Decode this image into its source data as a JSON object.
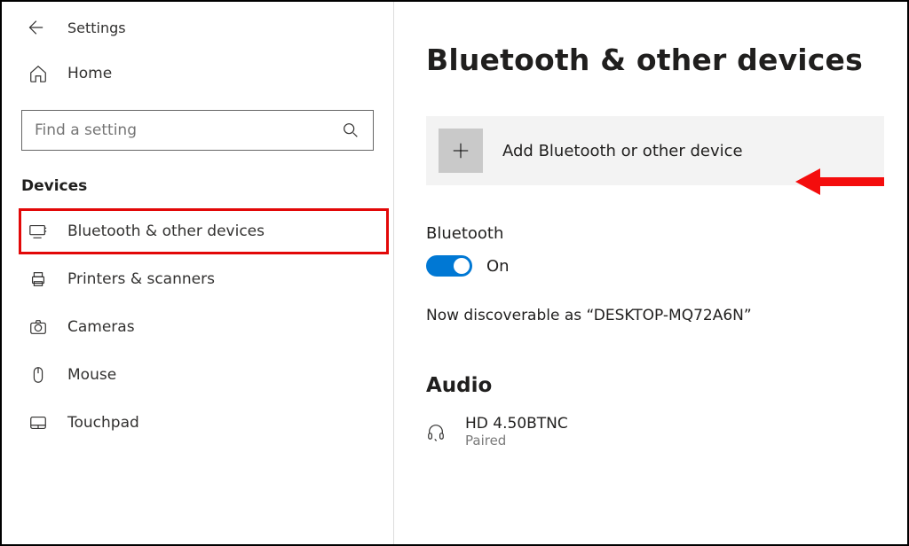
{
  "header": {
    "title": "Settings"
  },
  "home": {
    "label": "Home"
  },
  "search": {
    "placeholder": "Find a setting"
  },
  "category": {
    "heading": "Devices"
  },
  "nav": {
    "items": [
      {
        "label": "Bluetooth & other devices",
        "icon": "bluetooth-devices-icon",
        "selected": true
      },
      {
        "label": "Printers & scanners",
        "icon": "printer-icon",
        "selected": false
      },
      {
        "label": "Cameras",
        "icon": "camera-icon",
        "selected": false
      },
      {
        "label": "Mouse",
        "icon": "mouse-icon",
        "selected": false
      },
      {
        "label": "Touchpad",
        "icon": "touchpad-icon",
        "selected": false
      }
    ]
  },
  "main": {
    "page_title": "Bluetooth & other devices",
    "add_device_label": "Add Bluetooth or other device",
    "bluetooth_section": {
      "heading": "Bluetooth",
      "toggle_state": "On",
      "discoverable_text": "Now discoverable as “DESKTOP-MQ72A6N”"
    },
    "audio_section": {
      "heading": "Audio",
      "devices": [
        {
          "name": "HD 4.50BTNC",
          "status": "Paired"
        }
      ]
    }
  },
  "annotation": {
    "arrow_color": "#f40d0d",
    "highlight_color": "#e20808"
  }
}
